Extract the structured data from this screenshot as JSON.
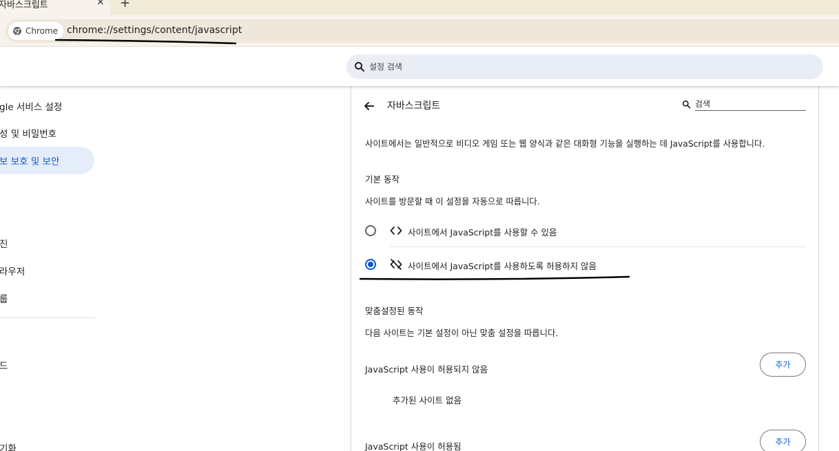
{
  "browser": {
    "tab_title": "자바스크립트",
    "tab_close": "×",
    "new_tab": "+",
    "chip_label": "Chrome",
    "url": "chrome://settings/content/javascript"
  },
  "header": {
    "search_placeholder": "설정 검색"
  },
  "sidebar": {
    "items": [
      {
        "label": "gle 서비스 설정"
      },
      {
        "label": "성 및 비밀번호"
      },
      {
        "label": "보 보호 및 보안",
        "active": true
      },
      {
        "label": "진"
      },
      {
        "label": "라우저"
      },
      {
        "label": "룹"
      },
      {
        "label": "드"
      },
      {
        "label": "기화"
      }
    ]
  },
  "page": {
    "title": "자바스크립트",
    "search_placeholder": "검색",
    "description": "사이트에서는 일반적으로 비디오 게임 또는 웹 양식과 같은 대화형 기능을 실행하는 데 JavaScript를 사용합니다.",
    "default_behavior": {
      "heading": "기본 동작",
      "sub": "사이트를 방문할 때 이 설정을 자동으로 따릅니다.",
      "options": [
        {
          "label": "사이트에서 JavaScript를 사용할 수 있음",
          "icon": "code-icon",
          "checked": false
        },
        {
          "label": "사이트에서 JavaScript를 사용하도록 허용하지 않음",
          "icon": "code-off-icon",
          "checked": true
        }
      ]
    },
    "custom_behavior": {
      "heading": "맞춤설정된 동작",
      "sub": "다음 사이트는 기본 설정이 아닌 맞춤 설정을 따릅니다.",
      "blocked_title": "JavaScript 사용이 허용되지 않음",
      "blocked_empty": "추가된 사이트 없음",
      "allowed_title": "JavaScript 사용이 허용됨",
      "add_label": "추가"
    }
  },
  "colors": {
    "accent": "#0b57d0",
    "active_nav_bg": "#e6edfa",
    "search_bg": "#e9eef6",
    "tabstrip_bg": "#f1ead6"
  }
}
